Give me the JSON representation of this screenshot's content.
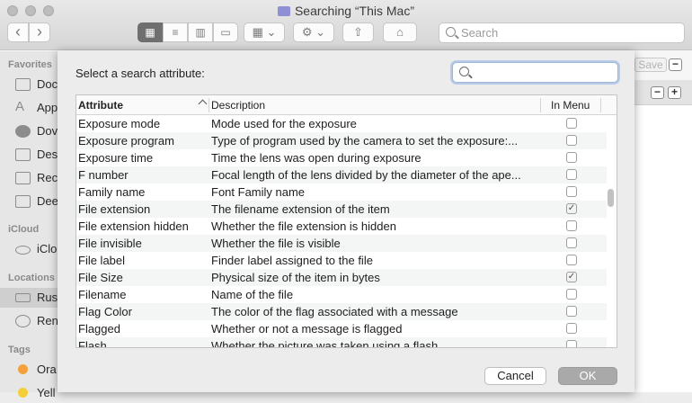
{
  "window": {
    "title": "Searching “This Mac”"
  },
  "toolbar": {
    "back_icon": "‹",
    "forward_icon": "›",
    "view_icons": [
      "▦",
      "≡",
      "▥",
      "▭"
    ],
    "group_icon": "▦ ⌄",
    "action_icon": "⚙ ⌄",
    "share_icon": "⇧",
    "tag_icon": "⌂",
    "search_placeholder": "Search"
  },
  "sidebar": {
    "favorites_header": "Favorites",
    "favorites": [
      "Doc",
      "App",
      "Dov",
      "Des",
      "Rec",
      "Dee"
    ],
    "icloud_header": "iCloud",
    "icloud_items": [
      "iClo"
    ],
    "locations_header": "Locations",
    "locations": [
      "Rus",
      "Ren"
    ],
    "tags_header": "Tags",
    "tags": [
      {
        "label": "Ora",
        "color": "#f5a13b"
      },
      {
        "label": "Yell",
        "color": "#f3cf3a"
      }
    ]
  },
  "right_panel": {
    "save_label": "Save",
    "minus": "−",
    "plus": "+"
  },
  "dialog": {
    "prompt": "Select a search attribute:",
    "search_value": "",
    "columns": {
      "attribute": "Attribute",
      "description": "Description",
      "in_menu": "In Menu"
    },
    "rows": [
      {
        "attribute": "Exposure mode",
        "description": "Mode used for the exposure",
        "checked": false
      },
      {
        "attribute": "Exposure program",
        "description": "Type of program used by the camera to set the exposure:...",
        "checked": false
      },
      {
        "attribute": "Exposure time",
        "description": "Time the lens was open during exposure",
        "checked": false
      },
      {
        "attribute": "F number",
        "description": "Focal length of the lens divided by the diameter of the ape...",
        "checked": false
      },
      {
        "attribute": "Family name",
        "description": "Font Family name",
        "checked": false
      },
      {
        "attribute": "File extension",
        "description": "The filename extension of the item",
        "checked": true
      },
      {
        "attribute": "File extension hidden",
        "description": "Whether the file extension is hidden",
        "checked": false
      },
      {
        "attribute": "File invisible",
        "description": "Whether the file is visible",
        "checked": false
      },
      {
        "attribute": "File label",
        "description": "Finder label assigned to the file",
        "checked": false
      },
      {
        "attribute": "File Size",
        "description": "Physical size of the item in bytes",
        "checked": true
      },
      {
        "attribute": "Filename",
        "description": "Name of the file",
        "checked": false
      },
      {
        "attribute": "Flag Color",
        "description": "The color of the flag associated with a message",
        "checked": false
      },
      {
        "attribute": "Flagged",
        "description": "Whether or not a message is flagged",
        "checked": false
      },
      {
        "attribute": "Flash",
        "description": "Whether the picture was taken using a flash",
        "checked": false
      }
    ],
    "cancel_label": "Cancel",
    "ok_label": "OK",
    "checkmark": "✓"
  }
}
